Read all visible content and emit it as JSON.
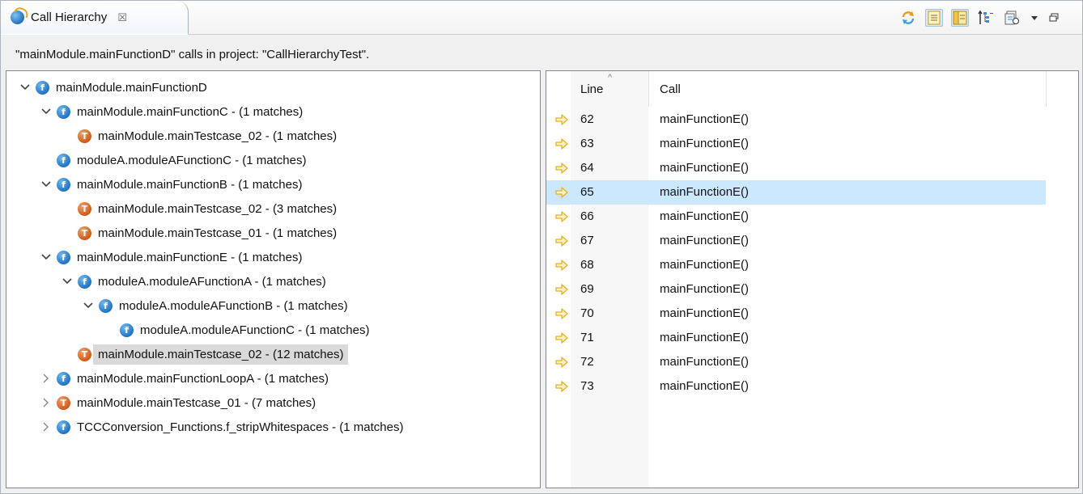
{
  "tab": {
    "title": "Call Hierarchy",
    "close_symbol": "☒"
  },
  "toolbar": {
    "icons": [
      "refresh-icon",
      "show-references-icon",
      "show-split-icon",
      "layout-icon",
      "history-icon",
      "view-menu-icon",
      "minimize-icon"
    ]
  },
  "description": "\"mainModule.mainFunctionD\" calls in project: \"CallHierarchyTest\".",
  "tree": {
    "nodes": [
      {
        "label": "mainModule.mainFunctionD",
        "icon": "function-icon",
        "twisty": "expanded"
      },
      {
        "label": "mainModule.mainFunctionC  -  (1 matches)",
        "icon": "function-icon",
        "twisty": "expanded"
      },
      {
        "label": "mainModule.mainTestcase_02  -  (1 matches)",
        "icon": "testcase-icon",
        "twisty": "none"
      },
      {
        "label": "moduleA.moduleAFunctionC  -  (1 matches)",
        "icon": "function-icon",
        "twisty": "none"
      },
      {
        "label": "mainModule.mainFunctionB  -  (1 matches)",
        "icon": "function-icon",
        "twisty": "expanded"
      },
      {
        "label": "mainModule.mainTestcase_02  -  (3 matches)",
        "icon": "testcase-icon",
        "twisty": "none"
      },
      {
        "label": "mainModule.mainTestcase_01  -  (1 matches)",
        "icon": "testcase-icon",
        "twisty": "none"
      },
      {
        "label": "mainModule.mainFunctionE  -  (1 matches)",
        "icon": "function-icon",
        "twisty": "expanded"
      },
      {
        "label": "moduleA.moduleAFunctionA  -  (1 matches)",
        "icon": "function-icon",
        "twisty": "expanded"
      },
      {
        "label": "moduleA.moduleAFunctionB  -  (1 matches)",
        "icon": "function-icon",
        "twisty": "expanded"
      },
      {
        "label": "moduleA.moduleAFunctionC  -  (1 matches)",
        "icon": "function-icon",
        "twisty": "none"
      },
      {
        "label": "mainModule.mainTestcase_02  -  (12 matches)",
        "icon": "testcase-icon",
        "twisty": "none",
        "selected": true
      },
      {
        "label": "mainModule.mainFunctionLoopA  -  (1 matches)",
        "icon": "function-icon",
        "twisty": "collapsed"
      },
      {
        "label": "mainModule.mainTestcase_01  -  (7 matches)",
        "icon": "testcase-icon",
        "twisty": "collapsed"
      },
      {
        "label": "TCCConversion_Functions.f_stripWhitespaces  -  (1 matches)",
        "icon": "function-icon",
        "twisty": "collapsed"
      }
    ]
  },
  "table": {
    "columns": {
      "line": "Line",
      "call": "Call"
    },
    "sort_indicator": "^",
    "rows": [
      {
        "line": "62",
        "call": "mainFunctionE()"
      },
      {
        "line": "63",
        "call": "mainFunctionE()"
      },
      {
        "line": "64",
        "call": "mainFunctionE()"
      },
      {
        "line": "65",
        "call": "mainFunctionE()",
        "selected": true
      },
      {
        "line": "66",
        "call": "mainFunctionE()"
      },
      {
        "line": "67",
        "call": "mainFunctionE()"
      },
      {
        "line": "68",
        "call": "mainFunctionE()"
      },
      {
        "line": "69",
        "call": "mainFunctionE()"
      },
      {
        "line": "70",
        "call": "mainFunctionE()"
      },
      {
        "line": "71",
        "call": "mainFunctionE()"
      },
      {
        "line": "72",
        "call": "mainFunctionE()"
      },
      {
        "line": "73",
        "call": "mainFunctionE()"
      }
    ]
  },
  "colors": {
    "function_icon": "#1f74c6",
    "testcase_icon": "#cf5a1a",
    "selection_tree": "#d9d9d9",
    "selection_table": "#cce8ff",
    "arrow": "#e8b020"
  }
}
